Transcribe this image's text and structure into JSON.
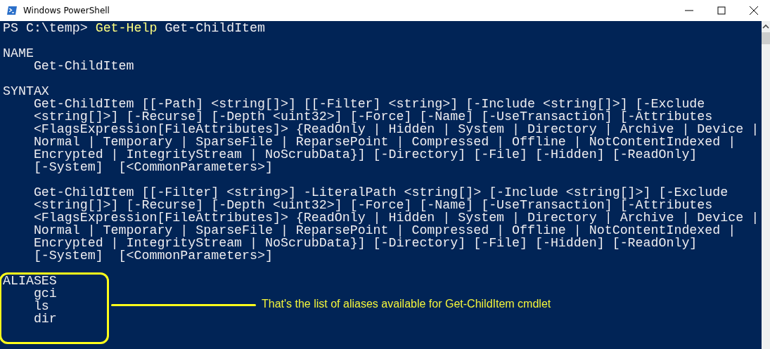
{
  "window": {
    "title": "Windows PowerShell"
  },
  "console": {
    "prompt": "PS C:\\temp> ",
    "command": "Get-Help",
    "argument": "Get-ChildItem",
    "sections": [
      {
        "heading": "NAME",
        "blocks": [
          [
            "Get-ChildItem"
          ]
        ]
      },
      {
        "heading": "SYNTAX",
        "blocks": [
          [
            "Get-ChildItem [[-Path] <string[]>] [[-Filter] <string>] [-Include <string[]>] [-Exclude",
            "<string[]>] [-Recurse] [-Depth <uint32>] [-Force] [-Name] [-UseTransaction] [-Attributes",
            "<FlagsExpression[FileAttributes]> {ReadOnly | Hidden | System | Directory | Archive | Device |",
            "Normal | Temporary | SparseFile | ReparsePoint | Compressed | Offline | NotContentIndexed |",
            "Encrypted | IntegrityStream | NoScrubData}] [-Directory] [-File] [-Hidden] [-ReadOnly]",
            "[-System]  [<CommonParameters>]"
          ],
          [
            "Get-ChildItem [[-Filter] <string>] -LiteralPath <string[]> [-Include <string[]>] [-Exclude",
            "<string[]>] [-Recurse] [-Depth <uint32>] [-Force] [-Name] [-UseTransaction] [-Attributes",
            "<FlagsExpression[FileAttributes]> {ReadOnly | Hidden | System | Directory | Archive | Device |",
            "Normal | Temporary | SparseFile | ReparsePoint | Compressed | Offline | NotContentIndexed |",
            "Encrypted | IntegrityStream | NoScrubData}] [-Directory] [-File] [-Hidden] [-ReadOnly]",
            "[-System]  [<CommonParameters>]"
          ]
        ]
      },
      {
        "heading": "ALIASES",
        "blocks": [
          [
            "gci",
            "ls",
            "dir"
          ]
        ]
      }
    ]
  },
  "annotation": {
    "text": "That's the list of aliases available for Get-ChildItem cmdlet"
  }
}
